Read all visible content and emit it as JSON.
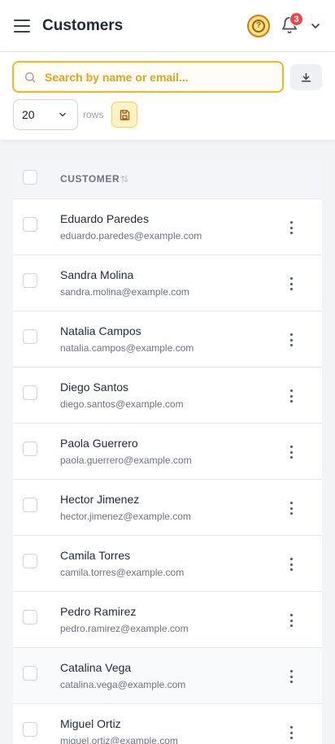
{
  "header": {
    "title": "Customers",
    "notification_count": "3"
  },
  "toolbar": {
    "search_placeholder": "Search by name or email...",
    "rows_per_page": "20",
    "rows_label": "rows"
  },
  "table": {
    "column_header": "CUSTOMER",
    "rows": [
      {
        "name": "Eduardo Paredes",
        "email": "eduardo.paredes@example.com"
      },
      {
        "name": "Sandra Molina",
        "email": "sandra.molina@example.com"
      },
      {
        "name": "Natalia Campos",
        "email": "natalia.campos@example.com"
      },
      {
        "name": "Diego Santos",
        "email": "diego.santos@example.com"
      },
      {
        "name": "Paola Guerrero",
        "email": "paola.guerrero@example.com"
      },
      {
        "name": "Hector Jimenez",
        "email": "hector.jimenez@example.com"
      },
      {
        "name": "Camila Torres",
        "email": "camila.torres@example.com"
      },
      {
        "name": "Pedro Ramirez",
        "email": "pedro.ramirez@example.com"
      },
      {
        "name": "Catalina Vega",
        "email": "catalina.vega@example.com"
      },
      {
        "name": "Miguel Ortiz",
        "email": "miguel.ortiz@example.com"
      }
    ]
  },
  "icons": {
    "menu": "hamburger-menu-icon",
    "help": "question-circle-icon",
    "notifications": "bell-icon",
    "account": "chevron-down-icon",
    "search": "search-icon",
    "export": "download-icon",
    "save": "floppy-disk-icon",
    "sort": "sort-arrows-icon",
    "row_actions": "vertical-ellipsis-icon"
  },
  "colors": {
    "accent": "#f5b325",
    "accent_dark": "#d97706",
    "badge": "#ef4444"
  }
}
